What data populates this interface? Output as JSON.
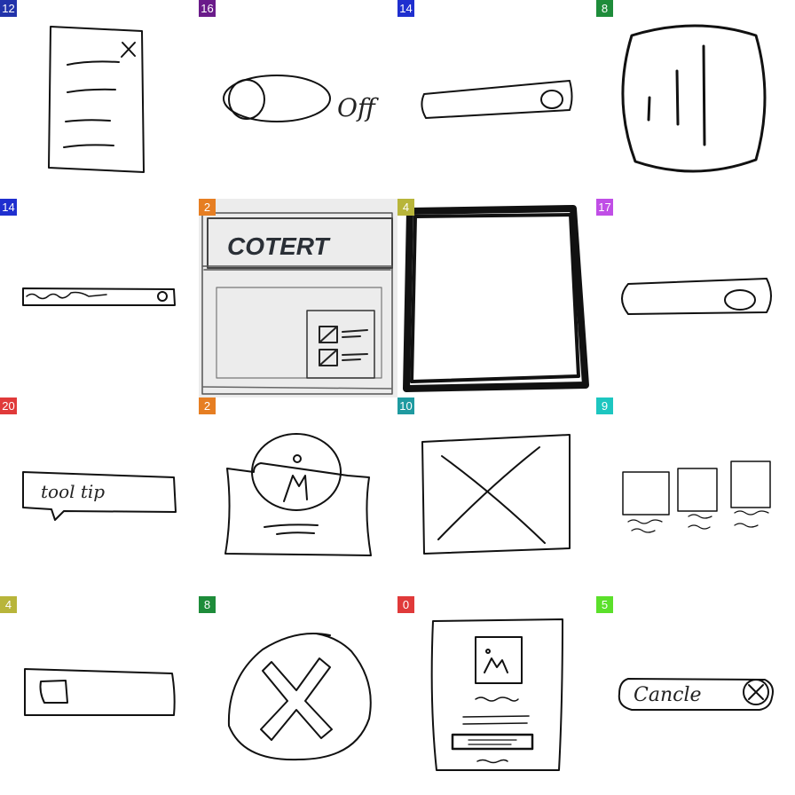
{
  "tiles": [
    {
      "id": 0,
      "label": "12",
      "color": "#2233aa",
      "sketch": "document-close"
    },
    {
      "id": 1,
      "label": "16",
      "color": "#6a1b8a",
      "sketch": "toggle-off",
      "text": "Off"
    },
    {
      "id": 2,
      "label": "14",
      "color": "#1f2fcf",
      "sketch": "slider"
    },
    {
      "id": 3,
      "label": "8",
      "color": "#1e8c3a",
      "sketch": "signal-bars"
    },
    {
      "id": 4,
      "label": "14",
      "color": "#1f2fcf",
      "sketch": "progress-slider"
    },
    {
      "id": 5,
      "label": "2",
      "color": "#e67e22",
      "sketch": "content-panel",
      "text": "COTERT"
    },
    {
      "id": 6,
      "label": "4",
      "color": "#b8b53a",
      "sketch": "thick-box"
    },
    {
      "id": 7,
      "label": "17",
      "color": "#c04ee6",
      "sketch": "slider-large"
    },
    {
      "id": 8,
      "label": "20",
      "color": "#e03a3a",
      "sketch": "tooltip",
      "text": "tool tip"
    },
    {
      "id": 9,
      "label": "2",
      "color": "#e67e22",
      "sketch": "profile-card"
    },
    {
      "id": 10,
      "label": "10",
      "color": "#1f9aa0",
      "sketch": "image-placeholder"
    },
    {
      "id": 11,
      "label": "9",
      "color": "#1dc6c0",
      "sketch": "thumbnail-grid"
    },
    {
      "id": 12,
      "label": "4",
      "color": "#b8b53a",
      "sketch": "switch-box"
    },
    {
      "id": 13,
      "label": "8",
      "color": "#1e8c3a",
      "sketch": "x-circle"
    },
    {
      "id": 14,
      "label": "0",
      "color": "#e03a3a",
      "sketch": "image-card"
    },
    {
      "id": 15,
      "label": "5",
      "color": "#5be02a",
      "sketch": "cancel-button",
      "text": "Cancle"
    }
  ]
}
